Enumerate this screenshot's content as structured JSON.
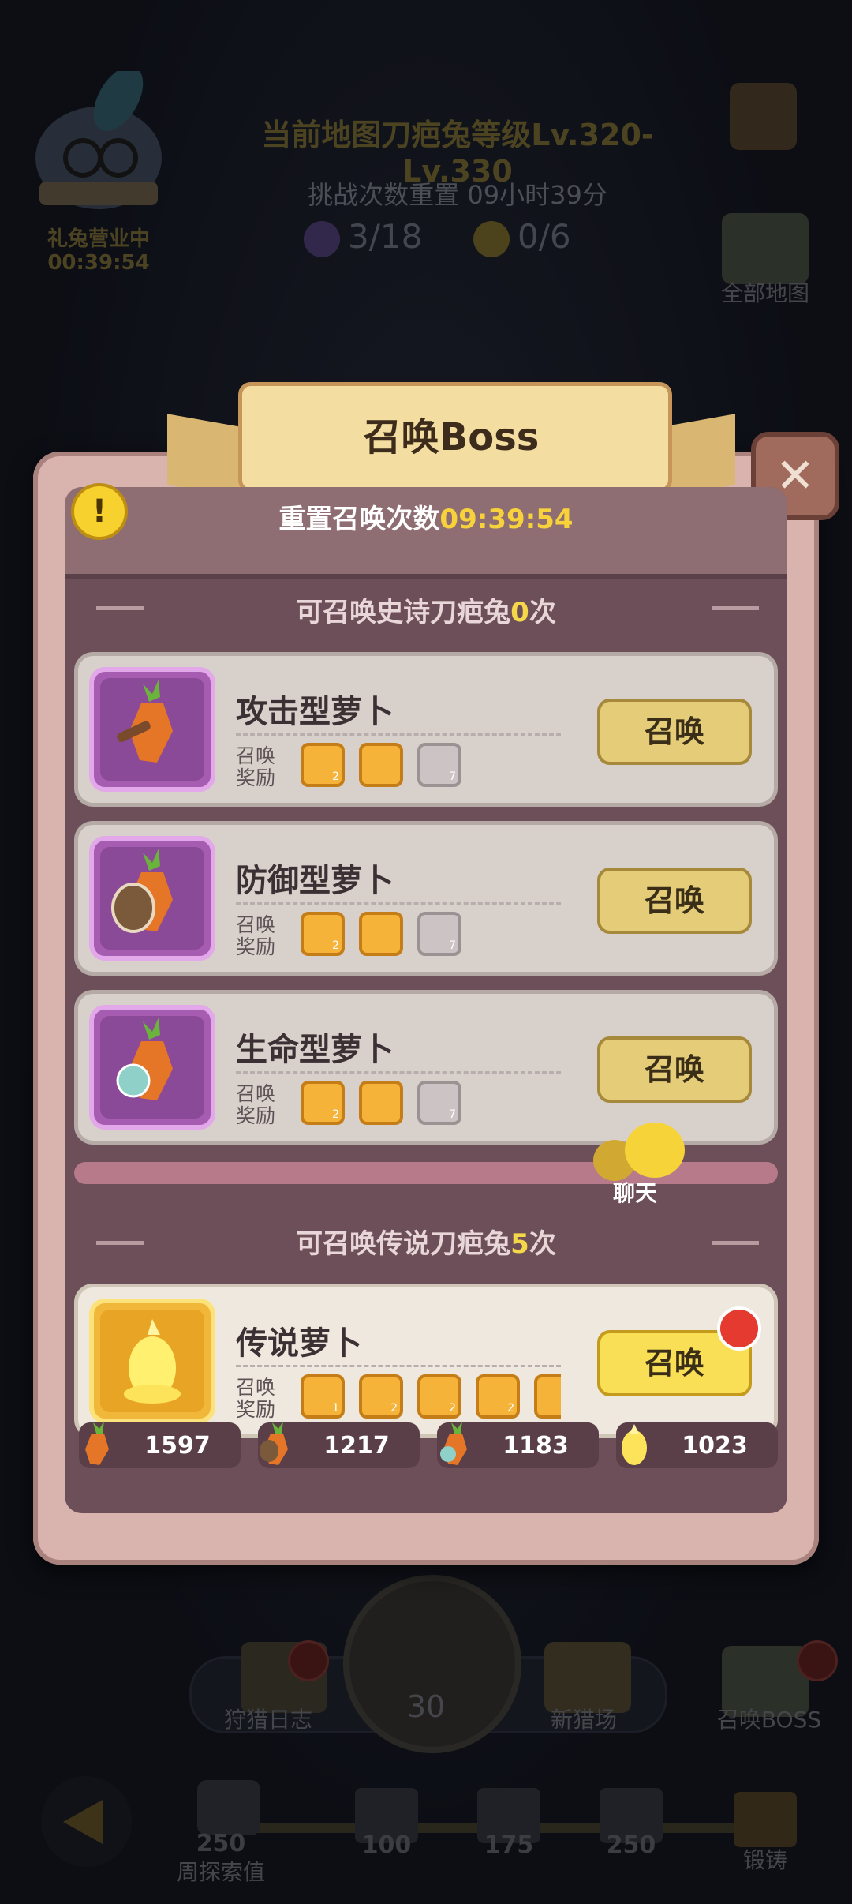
{
  "background": {
    "map_title": "当前地图刀疤兔等级Lv.320-Lv.330",
    "reset_text": "挑战次数重置 09小时39分",
    "count_purple": "3/18",
    "count_yellow": "0/6",
    "shop_label": "礼兔营业中",
    "shop_time": "00:39:54",
    "all_maps": "全部地图",
    "hunt_log": "狩猎日志",
    "compass_value": "30",
    "new_hunt": "新猎场",
    "summon_boss": "召唤BOSS",
    "explore_value": "250",
    "explore_label": "周探索值",
    "milestones": [
      "100",
      "175",
      "250"
    ],
    "forge": "锻铸"
  },
  "modal": {
    "title": "召唤Boss",
    "reset_label": "重置召唤次数",
    "reset_time": "09:39:54",
    "epic_section": {
      "prefix": "可召唤史诗刀疤兔",
      "count": "0",
      "suffix": "次"
    },
    "legend_section": {
      "prefix": "可召唤传说刀疤兔",
      "count": "5",
      "suffix": "次"
    },
    "reward_label": "召唤\n奖励",
    "summon_label": "召唤",
    "cards": [
      {
        "name": "攻击型萝卜",
        "rewards": [
          {
            "num": "2"
          },
          {
            "num": ""
          },
          {
            "num": "7"
          }
        ]
      },
      {
        "name": "防御型萝卜",
        "rewards": [
          {
            "num": "2"
          },
          {
            "num": ""
          },
          {
            "num": "7"
          }
        ]
      },
      {
        "name": "生命型萝卜",
        "rewards": [
          {
            "num": "2"
          },
          {
            "num": ""
          },
          {
            "num": "7"
          }
        ]
      }
    ],
    "legend_card": {
      "name": "传说萝卜",
      "rewards": [
        {
          "num": "1"
        },
        {
          "num": "2"
        },
        {
          "num": "2"
        },
        {
          "num": "2"
        },
        {
          "num": ""
        }
      ]
    },
    "chat_label": "聊天",
    "resources": [
      "1597",
      "1217",
      "1183",
      "1023"
    ]
  },
  "colors": {
    "accent_yellow": "#f7d23a",
    "modal_frame": "#d9b3ad",
    "epic_purple": "#a55cb1",
    "legend_gold": "#f1b73b"
  }
}
